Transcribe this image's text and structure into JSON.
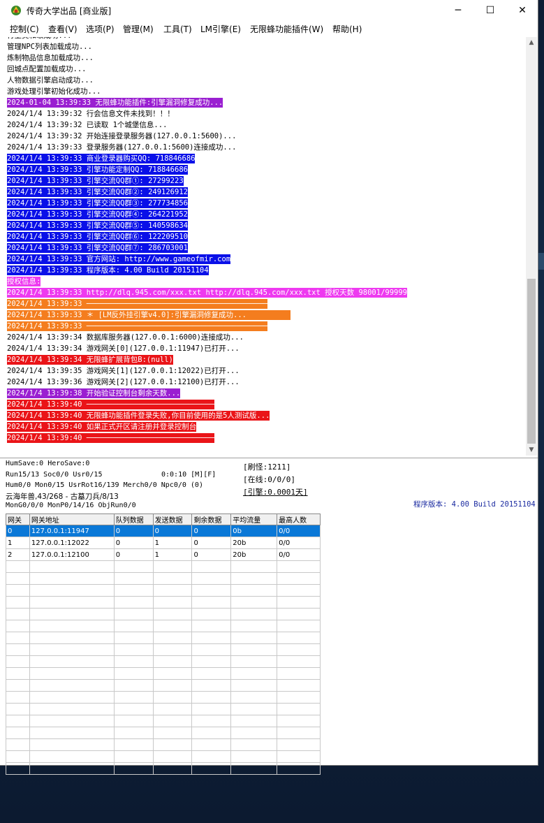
{
  "window": {
    "title": "传奇大学出品 [商业版]",
    "controls": {
      "minimize": "─",
      "maximize": "☐",
      "close": "✕"
    }
  },
  "menu": [
    "控制(C)",
    "查看(V)",
    "选项(P)",
    "管理(M)",
    "工具(T)",
    "LM引擎(E)",
    "无限蜂功能插件(W)",
    "帮助(H)"
  ],
  "log": [
    {
      "text": "行全灵和取成功...",
      "style": ""
    },
    {
      "text": "管理NPC列表加载成功...",
      "style": ""
    },
    {
      "text": "炼制物品信息加载成功...",
      "style": ""
    },
    {
      "text": "回城点配置加载成功...",
      "style": ""
    },
    {
      "text": "人物数据引擎启动成功...",
      "style": ""
    },
    {
      "text": "游戏处理引擎初始化成功...",
      "style": ""
    },
    {
      "text": "2024-01-04 13:39:33 无限蜂功能插件:引擎漏洞修复成功...",
      "style": "purple"
    },
    {
      "text": "2024/1/4 13:39:32 行会信息文件未找到！！！",
      "style": ""
    },
    {
      "text": "2024/1/4 13:39:32 已读取 1个城堡信息...",
      "style": ""
    },
    {
      "text": "2024/1/4 13:39:32 开始连接登录服务器(127.0.0.1:5600)...",
      "style": ""
    },
    {
      "text": "2024/1/4 13:39:33 登录服务器(127.0.0.1:5600)连接成功...",
      "style": ""
    },
    {
      "text": "2024/1/4 13:39:33 商业登录器购买QQ: 718846686",
      "style": "blue"
    },
    {
      "text": "2024/1/4 13:39:33 引擎功能定制QQ: 718846686",
      "style": "blue"
    },
    {
      "text": "2024/1/4 13:39:33 引擎交流QQ群①: 27299223",
      "style": "blue"
    },
    {
      "text": "2024/1/4 13:39:33 引擎交流QQ群②: 249126912",
      "style": "blue"
    },
    {
      "text": "2024/1/4 13:39:33 引擎交流QQ群③: 277734856",
      "style": "blue"
    },
    {
      "text": "2024/1/4 13:39:33 引擎交流QQ群④: 264221952",
      "style": "blue"
    },
    {
      "text": "2024/1/4 13:39:33 引擎交流QQ群⑤: 140598634",
      "style": "blue"
    },
    {
      "text": "2024/1/4 13:39:33 引擎交流QQ群⑥: 122209510",
      "style": "blue"
    },
    {
      "text": "2024/1/4 13:39:33 引擎交流QQ群⑦: 286703001",
      "style": "blue"
    },
    {
      "text": "2024/1/4 13:39:33 官方网站: http://www.gameofmir.com",
      "style": "blue"
    },
    {
      "text": "2024/1/4 13:39:33 程序版本: 4.00 Build 20151104",
      "style": "blue"
    },
    {
      "text": "授权信息:",
      "style": "pink"
    },
    {
      "text": "2024/1/4 13:39:33 http://dlq.945.com/xxx.txt http://dlq.945.com/xxx.txt 授权天数 98001/99999",
      "style": "pink"
    },
    {
      "text": "2024/1/4 13:39:33 ─────────────────────────────────────────",
      "style": "orange"
    },
    {
      "text": "2024/1/4 13:39:33 ＊ [LM反外挂引擎v4.0]:引擎漏洞修复成功...          ",
      "style": "orange"
    },
    {
      "text": "2024/1/4 13:39:33 ─────────────────────────────────────────",
      "style": "orange"
    },
    {
      "text": "2024/1/4 13:39:34 数据库服务器(127.0.0.1:6000)连接成功...",
      "style": ""
    },
    {
      "text": "2024/1/4 13:39:34 游戏网关[0](127.0.0.1:11947)已打开...",
      "style": ""
    },
    {
      "text": "2024/1/4 13:39:34 无限蜂扩展背包B:(null)",
      "style": "red"
    },
    {
      "text": "2024/1/4 13:39:35 游戏网关[1](127.0.0.1:12022)已打开...",
      "style": ""
    },
    {
      "text": "2024/1/4 13:39:36 游戏网关[2](127.0.0.1:12100)已打开...",
      "style": ""
    },
    {
      "text": "2024/1/4 13:39:38 开始验证控制台剩余天数...",
      "style": "purple"
    },
    {
      "text": "2024/1/4 13:39:40 ─────────────────────────────",
      "style": "red"
    },
    {
      "text": "2024/1/4 13:39:40 无限蜂功能插件登录失败,你目前使用的是5人测试版...",
      "style": "red"
    },
    {
      "text": "2024/1/4 13:39:40 如果正式开区请注册并登录控制台",
      "style": "red"
    },
    {
      "text": "2024/1/4 13:39:40 ─────────────────────────────",
      "style": "red"
    }
  ],
  "status": {
    "line1": "HumSave:0 HeroSave:0",
    "line2": "Run15/13 Soc0/0 Usr0/15",
    "timer": "0:0:10 [M][F]",
    "line3": "Hum0/0 Mon0/15 UsrRot16/139 Merch0/0 Npc0/0 (0)",
    "line4": "云海年兽,43/268 - 古墓刀兵/8/13",
    "line5": "MonG0/0/0 MonP0/14/16 ObjRun0/0",
    "spawn": "[刷怪:1211]",
    "online": "[在线:0/0/0]",
    "engine": "[引擎:0.0001天]",
    "version": "程序版本: 4.00 Build 20151104"
  },
  "gateway_table": {
    "headers": [
      "网关",
      "网关地址",
      "队列数据",
      "发送数据",
      "剩余数据",
      "平均流量",
      "最高人数"
    ],
    "rows": [
      [
        "0",
        "127.0.0.1:11947",
        "0",
        "0",
        "0",
        "0b",
        "0/0"
      ],
      [
        "1",
        "127.0.0.1:12022",
        "0",
        "1",
        "0",
        "20b",
        "0/0"
      ],
      [
        "2",
        "127.0.0.1:12100",
        "0",
        "1",
        "0",
        "20b",
        "0/0"
      ]
    ],
    "empty_rows": 18
  },
  "colors": {
    "purple": "#9a1fd1",
    "blue": "#0a10e8",
    "pink": "#ee3af0",
    "orange": "#f47d1e",
    "red": "#ea1418",
    "selection": "#0a78d7"
  }
}
